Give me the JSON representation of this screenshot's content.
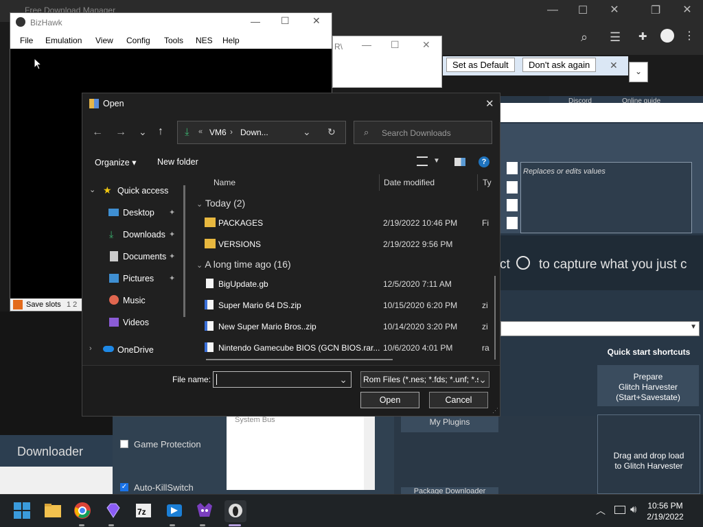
{
  "fdm": {
    "title": "Free Download Manager"
  },
  "browser": {
    "set_default": "Set as Default",
    "dont_ask": "Don't ask again"
  },
  "bizhawk": {
    "title": "BizHawk",
    "menu": [
      "File",
      "Emulation",
      "View",
      "Config",
      "Tools",
      "NES",
      "Help"
    ],
    "status": "Save slots",
    "slots": "1 2"
  },
  "small_window": {
    "text": "R\\"
  },
  "dialog": {
    "title": "Open",
    "path": [
      "VM6",
      "Down..."
    ],
    "search_placeholder": "Search Downloads",
    "organize": "Organize",
    "new_folder": "New folder",
    "sidebar": [
      {
        "label": "Quick access",
        "icon": "star-icon"
      },
      {
        "label": "Desktop",
        "icon": "desktop-icon",
        "pinned": true
      },
      {
        "label": "Downloads",
        "icon": "download-icon",
        "pinned": true
      },
      {
        "label": "Documents",
        "icon": "documents-icon",
        "pinned": true
      },
      {
        "label": "Pictures",
        "icon": "pictures-icon",
        "pinned": true
      },
      {
        "label": "Music",
        "icon": "music-icon"
      },
      {
        "label": "Videos",
        "icon": "videos-icon"
      },
      {
        "label": "OneDrive",
        "icon": "cloud-icon"
      }
    ],
    "columns": {
      "name": "Name",
      "date": "Date modified",
      "type": "Ty"
    },
    "groups": [
      {
        "label": "Today (2)",
        "items": [
          {
            "name": "PACKAGES",
            "date": "2/19/2022 10:46 PM",
            "type": "Fi",
            "kind": "folder"
          },
          {
            "name": "VERSIONS",
            "date": "2/19/2022 9:56 PM",
            "type": "",
            "kind": "folder"
          }
        ]
      },
      {
        "label": "A long time ago (16)",
        "items": [
          {
            "name": "BigUpdate.gb",
            "date": "12/5/2020 7:11 AM",
            "type": "",
            "kind": "file"
          },
          {
            "name": "Super Mario 64 DS.zip",
            "date": "10/15/2020 6:20 PM",
            "type": "zi",
            "kind": "zip"
          },
          {
            "name": "New Super Mario Bros..zip",
            "date": "10/14/2020 3:20 PM",
            "type": "zi",
            "kind": "zip"
          },
          {
            "name": "Nintendo Gamecube BIOS (GCN BIOS.rar...",
            "date": "10/6/2020 4:01 PM",
            "type": "ra",
            "kind": "rar"
          }
        ]
      }
    ],
    "filename_label": "File name:",
    "filename_value": "",
    "filter": "Rom Files (*.nes; *.fds; *.unf; *.s",
    "open": "Open",
    "cancel": "Cancel"
  },
  "background": {
    "replaces": "Replaces or edits values",
    "toast_pre": "Select",
    "toast_post": "to capture what you just c",
    "quick_start": "Quick start shortcuts",
    "prepare": "Prepare\nGlitch Harvester\n(Start+Savestate)",
    "drag_drop": "Drag and drop load\nto Glitch Harvester",
    "downloader": "Downloader",
    "game_protection": "Game Protection",
    "auto_killswitch": "Auto-KillSwitch",
    "system_bus": "System Bus",
    "my_plugins": "My Plugins",
    "package_downloader": "Package Downloader",
    "discord": "Discord",
    "online_guide": "Online guide"
  },
  "taskbar": {
    "time": "10:56 PM",
    "date": "2/19/2022",
    "apps": [
      "windows-start-icon",
      "file-explorer-icon",
      "chrome-icon",
      "gem-icon",
      "7zip-icon",
      "arrow-app-icon",
      "rtc-icon",
      "bizhawk-icon"
    ]
  }
}
